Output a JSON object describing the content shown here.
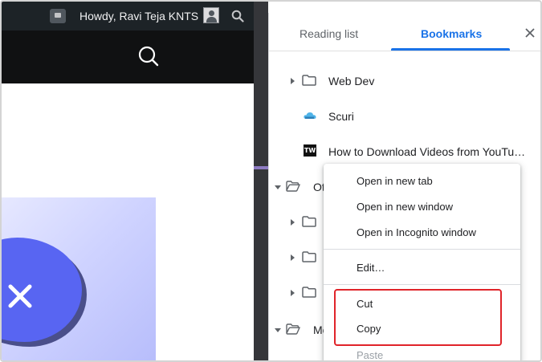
{
  "website": {
    "admin_bar": {
      "greeting": "Howdy, Ravi Teja KNTS"
    }
  },
  "side_panel": {
    "tabs": [
      {
        "label": "Reading list",
        "active": false
      },
      {
        "label": "Bookmarks",
        "active": true
      }
    ],
    "bookmarks": [
      {
        "type": "folder",
        "label": "Web Dev",
        "expanded": false
      },
      {
        "type": "link",
        "label": "Scuri",
        "icon": "cloud-favicon"
      },
      {
        "type": "link",
        "label": "How to Download Videos from YouTu…",
        "icon": "techwiser-favicon"
      },
      {
        "type": "folder",
        "label": "Ot",
        "expanded": true
      },
      {
        "type": "folder",
        "label": "",
        "expanded": false
      },
      {
        "type": "folder",
        "label": "",
        "expanded": false
      },
      {
        "type": "folder",
        "label": "",
        "expanded": false
      },
      {
        "type": "folder",
        "label": "Mo",
        "expanded": true
      }
    ],
    "favicon_tw_text": "TW"
  },
  "context_menu": {
    "items": [
      {
        "label": "Open in new tab",
        "enabled": true
      },
      {
        "label": "Open in new window",
        "enabled": true
      },
      {
        "label": "Open in Incognito window",
        "enabled": true
      },
      {
        "label": "Edit…",
        "enabled": true
      },
      {
        "label": "Cut",
        "enabled": true
      },
      {
        "label": "Copy",
        "enabled": true
      },
      {
        "label": "Paste",
        "enabled": false
      }
    ]
  },
  "colors": {
    "accent": "#1a73e8",
    "highlight_box": "#e0242a",
    "admin_bar": "#1d2327",
    "gutter": "#35363a"
  }
}
